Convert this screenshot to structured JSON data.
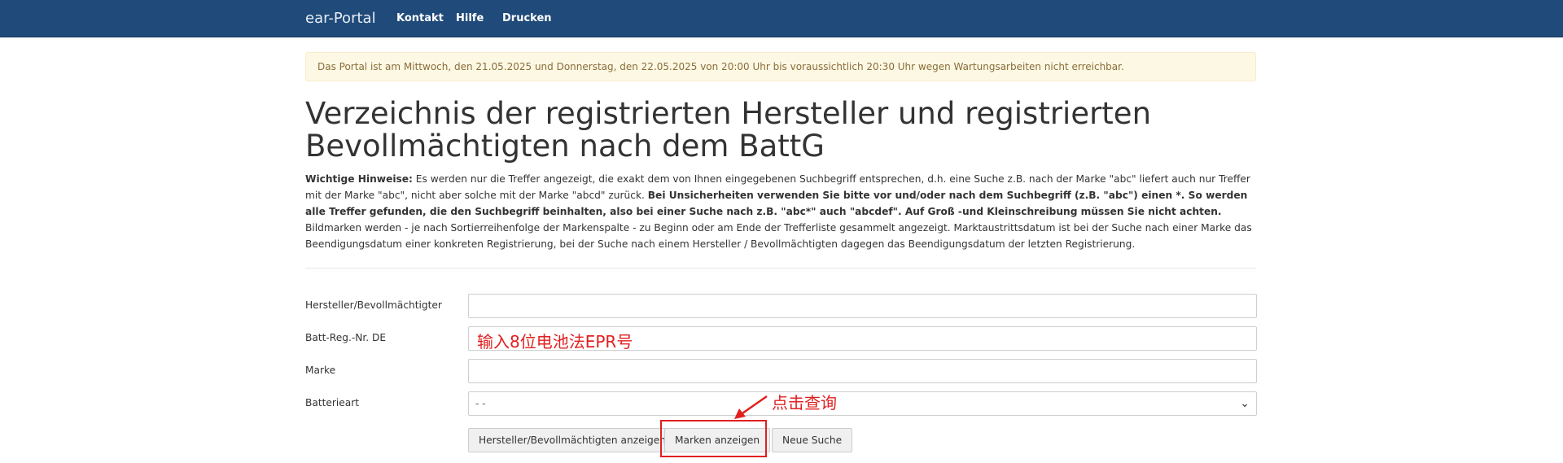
{
  "navbar": {
    "brand": "ear-Portal",
    "links": [
      "Kontakt",
      "Hilfe",
      "Drucken"
    ]
  },
  "alert": {
    "text": "Das Portal ist am Mittwoch, den 21.05.2025 und Donnerstag, den 22.05.2025 von 20:00 Uhr bis voraussichtlich 20:30 Uhr wegen Wartungsarbeiten nicht erreichbar."
  },
  "page": {
    "title": "Verzeichnis der registrierten Hersteller und registrierten Bevollmächtigten nach dem BattG"
  },
  "notes": {
    "lead": "Wichtige Hinweise:",
    "part1": " Es werden nur die Treffer angezeigt, die exakt dem von Ihnen eingegebenen Suchbegriff entsprechen, d.h. eine Suche z.B. nach der Marke \"abc\" liefert auch nur Treffer mit der Marke \"abc\", nicht aber solche mit der Marke \"abcd\" zurück. ",
    "bold": "Bei Unsicherheiten verwenden Sie bitte vor und/oder nach dem Suchbegriff (z.B. \"abc\") einen *. So werden alle Treffer gefunden, die den Suchbegriff beinhalten, also bei einer Suche nach z.B. \"abc*\" auch \"abcdef\". Auf Groß -und Kleinschreibung müssen Sie nicht achten.",
    "part2": " Bildmarken werden - je nach Sortierreihenfolge der Markenspalte - zu Beginn oder am Ende der Trefferliste gesammelt angezeigt. Marktaustrittsdatum ist bei der Suche nach einer Marke das Beendigungsdatum einer konkreten Registrierung, bei der Suche nach einem Hersteller / Bevollmächtigten dagegen das Beendigungsdatum der letzten Registrierung."
  },
  "form": {
    "labels": {
      "hersteller": "Hersteller/Bevollmächtigter",
      "regnr": "Batt-Reg.-Nr. DE",
      "marke": "Marke",
      "batterieart": "Batterieart"
    },
    "values": {
      "hersteller": "",
      "regnr": "",
      "marke": ""
    },
    "batterieart_selected": "- -",
    "buttons": {
      "hersteller": "Hersteller/Bevollmächtigten anzeigen",
      "marken": "Marken anzeigen",
      "neue": "Neue Suche"
    }
  },
  "annotations": {
    "input_hint": "输入8位电池法EPR号",
    "click_hint": "点击查询"
  },
  "colors": {
    "navbar": "#1f4a7a",
    "annotation": "#e02020",
    "alert_bg": "#fcf8e3"
  }
}
